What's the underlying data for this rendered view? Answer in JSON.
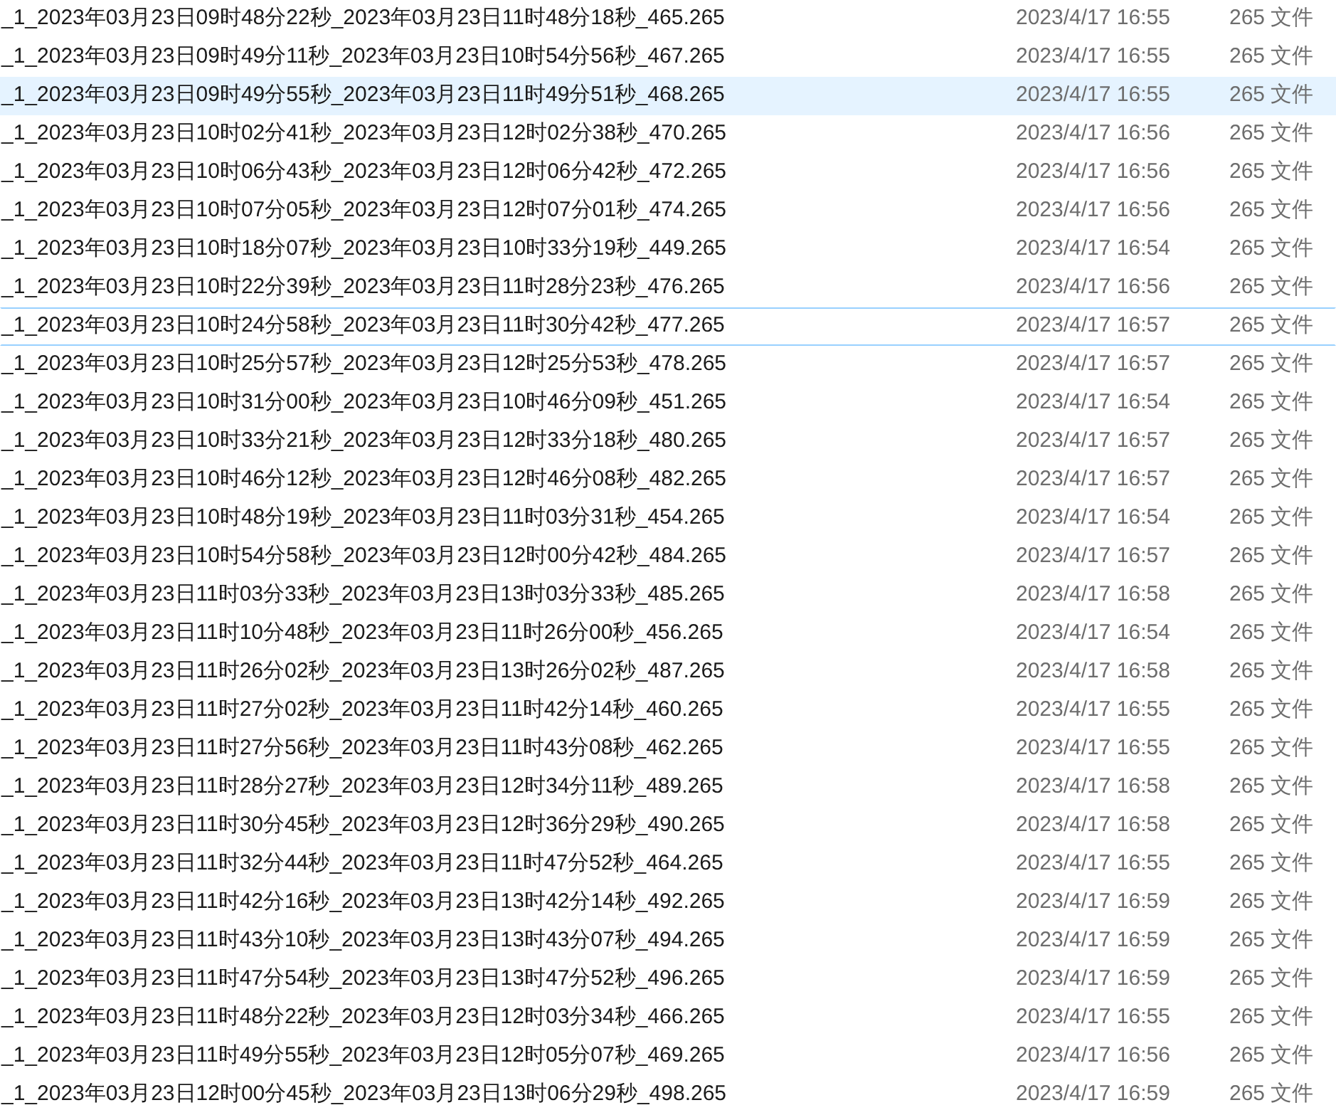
{
  "files": [
    {
      "name": "_1_2023年03月23日09时48分22秒_2023年03月23日11时48分18秒_465.265",
      "modified": "2023/4/17 16:55",
      "type": "265 文件",
      "selected": false,
      "focused": false
    },
    {
      "name": "_1_2023年03月23日09时49分11秒_2023年03月23日10时54分56秒_467.265",
      "modified": "2023/4/17 16:55",
      "type": "265 文件",
      "selected": false,
      "focused": false
    },
    {
      "name": "_1_2023年03月23日09时49分55秒_2023年03月23日11时49分51秒_468.265",
      "modified": "2023/4/17 16:55",
      "type": "265 文件",
      "selected": true,
      "focused": false
    },
    {
      "name": "_1_2023年03月23日10时02分41秒_2023年03月23日12时02分38秒_470.265",
      "modified": "2023/4/17 16:56",
      "type": "265 文件",
      "selected": false,
      "focused": false
    },
    {
      "name": "_1_2023年03月23日10时06分43秒_2023年03月23日12时06分42秒_472.265",
      "modified": "2023/4/17 16:56",
      "type": "265 文件",
      "selected": false,
      "focused": false
    },
    {
      "name": "_1_2023年03月23日10时07分05秒_2023年03月23日12时07分01秒_474.265",
      "modified": "2023/4/17 16:56",
      "type": "265 文件",
      "selected": false,
      "focused": false
    },
    {
      "name": "_1_2023年03月23日10时18分07秒_2023年03月23日10时33分19秒_449.265",
      "modified": "2023/4/17 16:54",
      "type": "265 文件",
      "selected": false,
      "focused": false
    },
    {
      "name": "_1_2023年03月23日10时22分39秒_2023年03月23日11时28分23秒_476.265",
      "modified": "2023/4/17 16:56",
      "type": "265 文件",
      "selected": false,
      "focused": false
    },
    {
      "name": "_1_2023年03月23日10时24分58秒_2023年03月23日11时30分42秒_477.265",
      "modified": "2023/4/17 16:57",
      "type": "265 文件",
      "selected": false,
      "focused": true
    },
    {
      "name": "_1_2023年03月23日10时25分57秒_2023年03月23日12时25分53秒_478.265",
      "modified": "2023/4/17 16:57",
      "type": "265 文件",
      "selected": false,
      "focused": false
    },
    {
      "name": "_1_2023年03月23日10时31分00秒_2023年03月23日10时46分09秒_451.265",
      "modified": "2023/4/17 16:54",
      "type": "265 文件",
      "selected": false,
      "focused": false
    },
    {
      "name": "_1_2023年03月23日10时33分21秒_2023年03月23日12时33分18秒_480.265",
      "modified": "2023/4/17 16:57",
      "type": "265 文件",
      "selected": false,
      "focused": false
    },
    {
      "name": "_1_2023年03月23日10时46分12秒_2023年03月23日12时46分08秒_482.265",
      "modified": "2023/4/17 16:57",
      "type": "265 文件",
      "selected": false,
      "focused": false
    },
    {
      "name": "_1_2023年03月23日10时48分19秒_2023年03月23日11时03分31秒_454.265",
      "modified": "2023/4/17 16:54",
      "type": "265 文件",
      "selected": false,
      "focused": false
    },
    {
      "name": "_1_2023年03月23日10时54分58秒_2023年03月23日12时00分42秒_484.265",
      "modified": "2023/4/17 16:57",
      "type": "265 文件",
      "selected": false,
      "focused": false
    },
    {
      "name": "_1_2023年03月23日11时03分33秒_2023年03月23日13时03分33秒_485.265",
      "modified": "2023/4/17 16:58",
      "type": "265 文件",
      "selected": false,
      "focused": false
    },
    {
      "name": "_1_2023年03月23日11时10分48秒_2023年03月23日11时26分00秒_456.265",
      "modified": "2023/4/17 16:54",
      "type": "265 文件",
      "selected": false,
      "focused": false
    },
    {
      "name": "_1_2023年03月23日11时26分02秒_2023年03月23日13时26分02秒_487.265",
      "modified": "2023/4/17 16:58",
      "type": "265 文件",
      "selected": false,
      "focused": false
    },
    {
      "name": "_1_2023年03月23日11时27分02秒_2023年03月23日11时42分14秒_460.265",
      "modified": "2023/4/17 16:55",
      "type": "265 文件",
      "selected": false,
      "focused": false
    },
    {
      "name": "_1_2023年03月23日11时27分56秒_2023年03月23日11时43分08秒_462.265",
      "modified": "2023/4/17 16:55",
      "type": "265 文件",
      "selected": false,
      "focused": false
    },
    {
      "name": "_1_2023年03月23日11时28分27秒_2023年03月23日12时34分11秒_489.265",
      "modified": "2023/4/17 16:58",
      "type": "265 文件",
      "selected": false,
      "focused": false
    },
    {
      "name": "_1_2023年03月23日11时30分45秒_2023年03月23日12时36分29秒_490.265",
      "modified": "2023/4/17 16:58",
      "type": "265 文件",
      "selected": false,
      "focused": false
    },
    {
      "name": "_1_2023年03月23日11时32分44秒_2023年03月23日11时47分52秒_464.265",
      "modified": "2023/4/17 16:55",
      "type": "265 文件",
      "selected": false,
      "focused": false
    },
    {
      "name": "_1_2023年03月23日11时42分16秒_2023年03月23日13时42分14秒_492.265",
      "modified": "2023/4/17 16:59",
      "type": "265 文件",
      "selected": false,
      "focused": false
    },
    {
      "name": "_1_2023年03月23日11时43分10秒_2023年03月23日13时43分07秒_494.265",
      "modified": "2023/4/17 16:59",
      "type": "265 文件",
      "selected": false,
      "focused": false
    },
    {
      "name": "_1_2023年03月23日11时47分54秒_2023年03月23日13时47分52秒_496.265",
      "modified": "2023/4/17 16:59",
      "type": "265 文件",
      "selected": false,
      "focused": false
    },
    {
      "name": "_1_2023年03月23日11时48分22秒_2023年03月23日12时03分34秒_466.265",
      "modified": "2023/4/17 16:55",
      "type": "265 文件",
      "selected": false,
      "focused": false
    },
    {
      "name": "_1_2023年03月23日11时49分55秒_2023年03月23日12时05分07秒_469.265",
      "modified": "2023/4/17 16:56",
      "type": "265 文件",
      "selected": false,
      "focused": false
    },
    {
      "name": "_1_2023年03月23日12时00分45秒_2023年03月23日13时06分29秒_498.265",
      "modified": "2023/4/17 16:59",
      "type": "265 文件",
      "selected": false,
      "focused": false
    }
  ]
}
